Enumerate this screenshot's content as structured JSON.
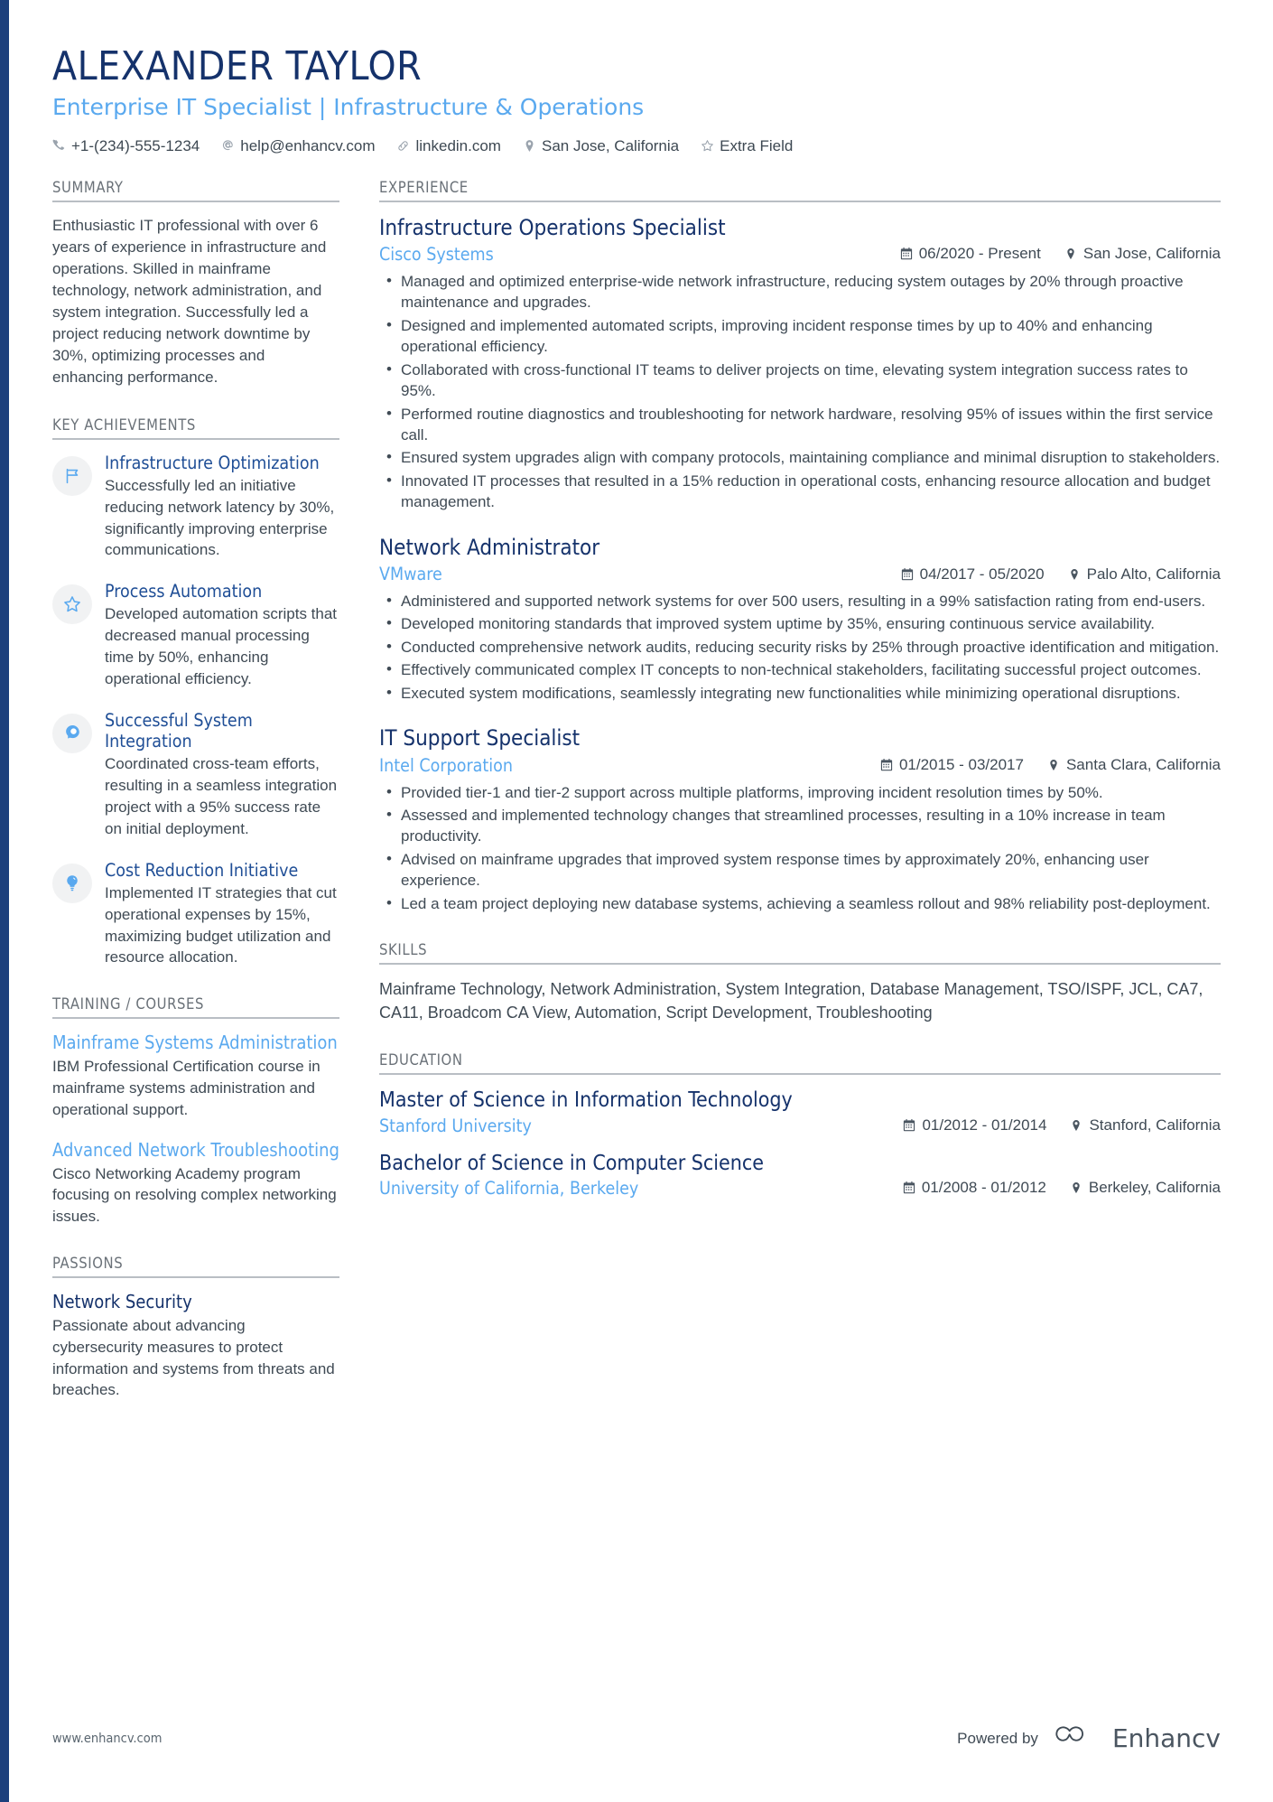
{
  "theme": {
    "navy": "#15326b",
    "light_blue": "#5aa9ef",
    "accent_bar": "#1c3f7c",
    "body_text": "#3f4a54",
    "section_label": "#6a7178"
  },
  "header": {
    "name": "ALEXANDER TAYLOR",
    "headline": "Enterprise IT Specialist | Infrastructure & Operations",
    "contacts": [
      {
        "icon": "phone-icon",
        "text": "+1-(234)-555-1234"
      },
      {
        "icon": "email-icon",
        "text": "help@enhancv.com"
      },
      {
        "icon": "link-icon",
        "text": "linkedin.com"
      },
      {
        "icon": "location-pin-icon",
        "text": "San Jose, California"
      },
      {
        "icon": "star-icon",
        "text": "Extra Field"
      }
    ]
  },
  "left": {
    "summary": {
      "title": "SUMMARY",
      "text": "Enthusiastic IT professional with over 6 years of experience in infrastructure and operations. Skilled in mainframe technology, network administration, and system integration. Successfully led a project reducing network downtime by 30%, optimizing processes and enhancing performance."
    },
    "key_achievements": {
      "title": "KEY ACHIEVEMENTS",
      "items": [
        {
          "icon": "flag-icon",
          "title": "Infrastructure Optimization",
          "desc": "Successfully led an initiative reducing network latency by 30%, significantly improving enterprise communications."
        },
        {
          "icon": "star-outline-icon",
          "title": "Process Automation",
          "desc": "Developed automation scripts that decreased manual processing time by 50%, enhancing operational efficiency."
        },
        {
          "icon": "head-idea-icon",
          "title": "Successful System Integration",
          "desc": "Coordinated cross-team efforts, resulting in a seamless integration project with a 95% success rate on initial deployment."
        },
        {
          "icon": "lightbulb-icon",
          "title": "Cost Reduction Initiative",
          "desc": "Implemented IT strategies that cut operational expenses by 15%, maximizing budget utilization and resource allocation."
        }
      ]
    },
    "training": {
      "title": "TRAINING / COURSES",
      "items": [
        {
          "title": "Mainframe Systems Administration",
          "desc": "IBM Professional Certification course in mainframe systems administration and operational support."
        },
        {
          "title": "Advanced Network Troubleshooting",
          "desc": "Cisco Networking Academy program focusing on resolving complex networking issues."
        }
      ]
    },
    "passions": {
      "title": "PASSIONS",
      "items": [
        {
          "title": "Network Security",
          "desc": "Passionate about advancing cybersecurity measures to protect information and systems from threats and breaches."
        }
      ]
    }
  },
  "right": {
    "experience": {
      "title": "EXPERIENCE",
      "jobs": [
        {
          "role": "Infrastructure Operations Specialist",
          "company": "Cisco Systems",
          "dates": "06/2020 - Present",
          "location": "San Jose, California",
          "bullets": [
            "Managed and optimized enterprise-wide network infrastructure, reducing system outages by 20% through proactive maintenance and upgrades.",
            "Designed and implemented automated scripts, improving incident response times by up to 40% and enhancing operational efficiency.",
            "Collaborated with cross-functional IT teams to deliver projects on time, elevating system integration success rates to 95%.",
            "Performed routine diagnostics and troubleshooting for network hardware, resolving 95% of issues within the first service call.",
            "Ensured system upgrades align with company protocols, maintaining compliance and minimal disruption to stakeholders.",
            "Innovated IT processes that resulted in a 15% reduction in operational costs, enhancing resource allocation and budget management."
          ]
        },
        {
          "role": "Network Administrator",
          "company": "VMware",
          "dates": "04/2017 - 05/2020",
          "location": "Palo Alto, California",
          "bullets": [
            "Administered and supported network systems for over 500 users, resulting in a 99% satisfaction rating from end-users.",
            "Developed monitoring standards that improved system uptime by 35%, ensuring continuous service availability.",
            "Conducted comprehensive network audits, reducing security risks by 25% through proactive identification and mitigation.",
            "Effectively communicated complex IT concepts to non-technical stakeholders, facilitating successful project outcomes.",
            "Executed system modifications, seamlessly integrating new functionalities while minimizing operational disruptions."
          ]
        },
        {
          "role": "IT Support Specialist",
          "company": "Intel Corporation",
          "dates": "01/2015 - 03/2017",
          "location": "Santa Clara, California",
          "bullets": [
            "Provided tier-1 and tier-2 support across multiple platforms, improving incident resolution times by 50%.",
            "Assessed and implemented technology changes that streamlined processes, resulting in a 10% increase in team productivity.",
            "Advised on mainframe upgrades that improved system response times by approximately 20%, enhancing user experience.",
            "Led a team project deploying new database systems, achieving a seamless rollout and 98% reliability post-deployment."
          ]
        }
      ]
    },
    "skills": {
      "title": "SKILLS",
      "text": "Mainframe Technology, Network Administration, System Integration, Database Management, TSO/ISPF, JCL, CA7, CA11, Broadcom CA View, Automation, Script Development, Troubleshooting"
    },
    "education": {
      "title": "EDUCATION",
      "items": [
        {
          "degree": "Master of Science in Information Technology",
          "school": "Stanford University",
          "dates": "01/2012 - 01/2014",
          "location": "Stanford, California"
        },
        {
          "degree": "Bachelor of Science in Computer Science",
          "school": "University of California, Berkeley",
          "dates": "01/2008 - 01/2012",
          "location": "Berkeley, California"
        }
      ]
    }
  },
  "footer": {
    "url": "www.enhancv.com",
    "powered_by": "Powered by",
    "brand": "Enhancv"
  }
}
